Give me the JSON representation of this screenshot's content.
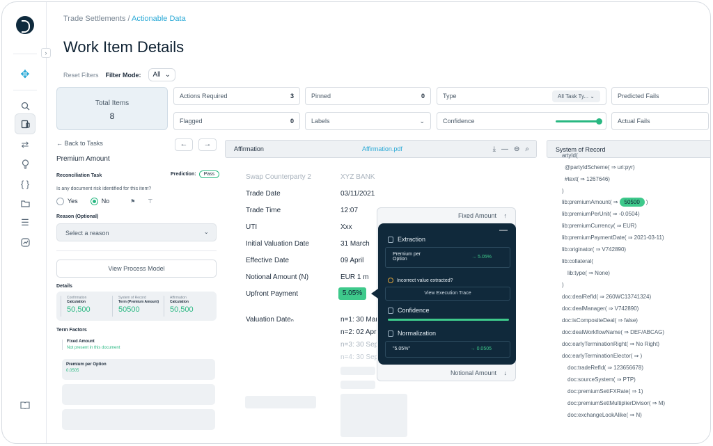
{
  "breadcrumb": {
    "parent": "Trade Settlements",
    "sep": "/",
    "current": "Actionable Data"
  },
  "page_title": "Work Item Details",
  "filters": {
    "reset": "Reset Filters",
    "mode_label": "Filter Mode:",
    "mode_value": "All"
  },
  "total": {
    "label": "Total Items",
    "value": "8"
  },
  "filter_boxes": {
    "actions_required": {
      "label": "Actions Required",
      "count": "3"
    },
    "pinned": {
      "label": "Pinned",
      "count": "0"
    },
    "type": {
      "label": "Type",
      "value": "All Task Ty..."
    },
    "predicted_fails": {
      "label": "Predicted Fails"
    },
    "flagged": {
      "label": "Flagged",
      "count": "0"
    },
    "labels": {
      "label": "Labels"
    },
    "confidence": {
      "label": "Confidence"
    },
    "actual_fails": {
      "label": "Actual Fails"
    }
  },
  "left": {
    "back": "Back to Tasks",
    "section_title": "Premium Amount",
    "recon": "Reconciliation Task",
    "prediction_label": "Prediction:",
    "prediction_value": "Pass",
    "risk_question": "Is any document risk identified for this item?",
    "yes": "Yes",
    "no": "No",
    "reason_label": "Reason (Optional)",
    "reason_placeholder": "Select a reason",
    "view_process": "View Process Model",
    "details": "Details",
    "detail_cols": [
      {
        "a": "Confirmation",
        "b": "Calculation",
        "v": "50,500"
      },
      {
        "a": "System of Record",
        "b": "Term (Premium Amount)",
        "v": "50500"
      },
      {
        "a": "Affirmation",
        "b": "Calculation",
        "v": "50,500"
      }
    ],
    "term_factors": "Term Factors",
    "tf1_title": "Fixed Amount",
    "tf1_note": "Not present in this document",
    "tf2_title": "Premium per Option",
    "tf2_value": "0.0505"
  },
  "docbar": {
    "title": "Affirmation",
    "file": "Affirmation.pdf"
  },
  "doc": {
    "rows": [
      {
        "label": "Swap Counterparty 2",
        "value": "XYZ BANK",
        "faded": true
      },
      {
        "label": "Trade Date",
        "value": "03/11/2021"
      },
      {
        "label": "Trade Time",
        "value": "12:07"
      },
      {
        "label": "UTI",
        "value": "Xxx"
      },
      {
        "label": "Initial Valuation Date",
        "value": "31 March"
      },
      {
        "label": "Effective Date",
        "value": "09 April"
      },
      {
        "label": "Notional Amount (N)",
        "value": "EUR 1 m"
      },
      {
        "label": "Upfront Payment",
        "value": "5.05%"
      }
    ],
    "valuation_label": "Valuation Dateₙ",
    "valuation_values": [
      "n=1: 30 March",
      "n=2: 02 April",
      "n=3: 30 Sep",
      "n=4: 30 Sep"
    ]
  },
  "popover": {
    "header": "Fixed Amount",
    "footer": "Notional Amount",
    "extraction": "Extraction",
    "ext_key": "Premium per Option",
    "ext_val": "→ 5.05%",
    "incorrect": "Incorrect value extracted?",
    "trace_btn": "View Execution Trace",
    "confidence": "Confidence",
    "normalization": "Normalization",
    "norm_key": "\"5.05%\"",
    "norm_val": "→ 0.0505"
  },
  "sor": {
    "title": "System of Record",
    "lines": [
      "artyId(",
      "@partyIdScheme( ⇒ uri:pyr)",
      "#text( ⇒ 1267646)",
      ")",
      "lib:premiumAmount( ⇒",
      "lib:premiumPerUnit( ⇒ -0.0504)",
      "lib:premiumCurrency( ⇒ EUR)",
      "lib:premiumPaymentDate( ⇒ 2021-03-11)",
      "lib:originator( ⇒ V742890)",
      "lib:collateral(",
      "lib:type( ⇒ None)",
      ")",
      "doc:dealRefId( ⇒ 260WC13741324)",
      "doc:dealManager( ⇒ V742890)",
      "doc:isCompositeDeal( ⇒ false)",
      "doc:dealWorkflowName( ⇒ DEF/ABCAG)",
      "doc:earlyTerminationRight( ⇒ No Right)",
      "doc:earlyTerminationElector( ⇒ )",
      "doc:tradeRefId( ⇒ 123656678)",
      "doc:sourceSystem( ⇒ PTP)",
      "doc:premiumSettFXRate( ⇒ 1)",
      "doc:premiumSettMultiplierDivisor( ⇒ M)",
      "doc:exchangeLookAlike( ⇒ N)"
    ],
    "highlight": "50500",
    "highlight_tail": ")"
  }
}
